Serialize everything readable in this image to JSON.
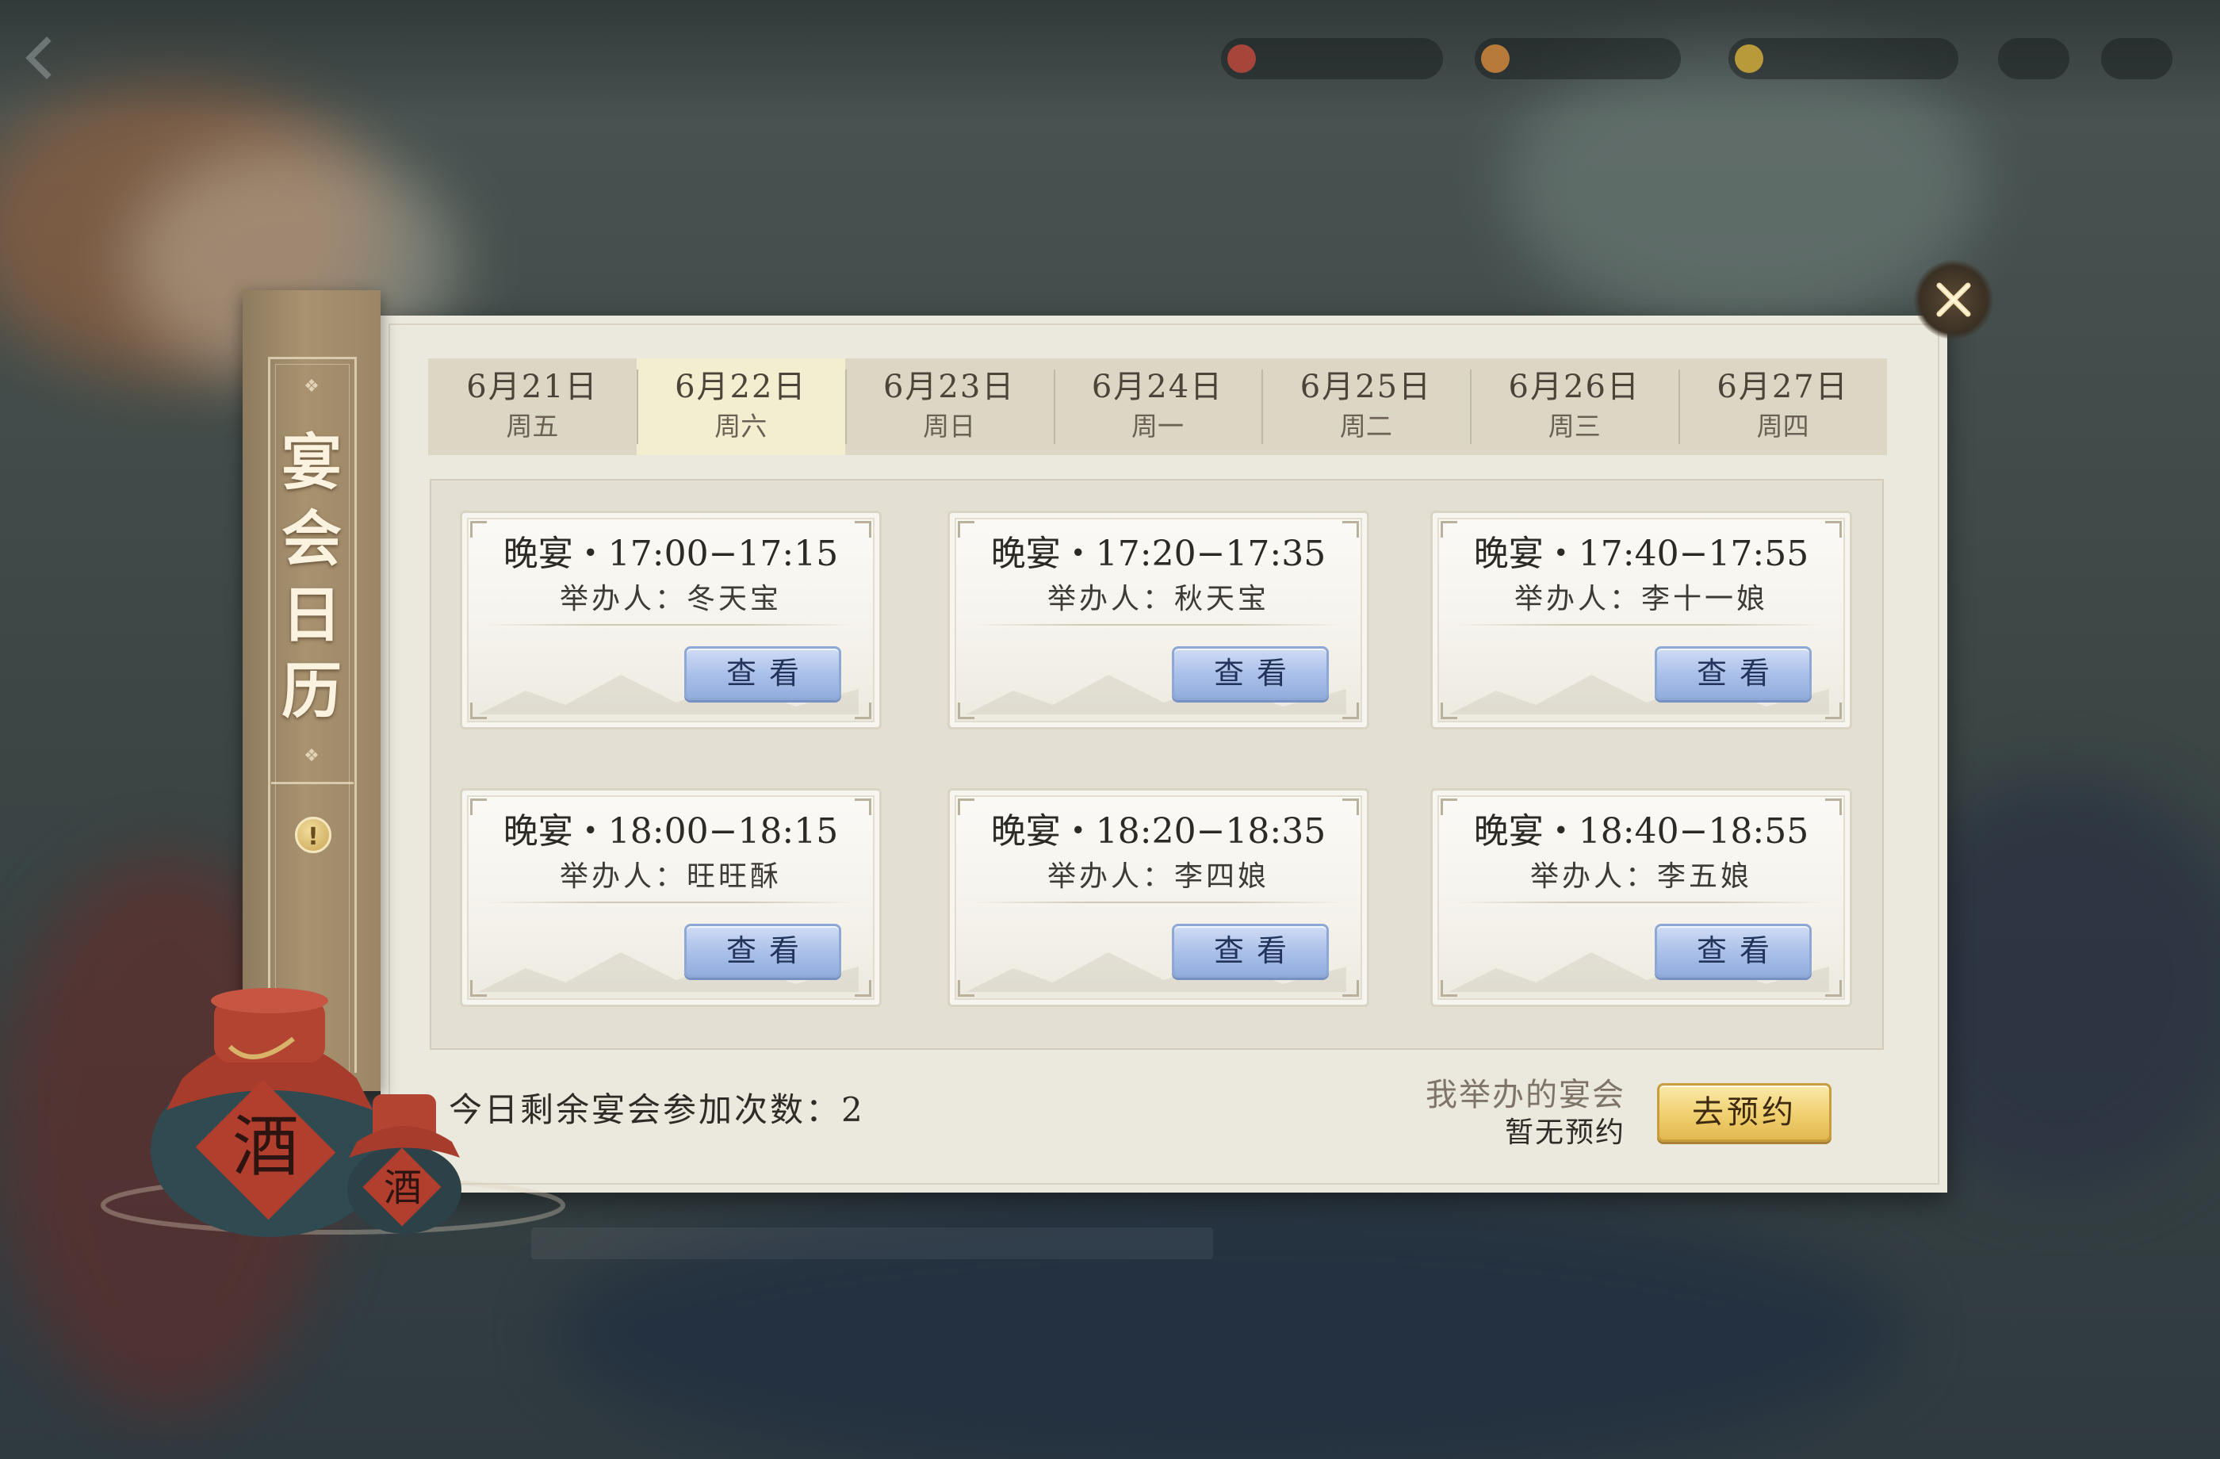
{
  "banner": {
    "title_chars": [
      "宴",
      "会",
      "日",
      "历"
    ],
    "info_glyph": "!"
  },
  "tabs": [
    {
      "date": "6月21日",
      "weekday": "周五",
      "active": false
    },
    {
      "date": "6月22日",
      "weekday": "周六",
      "active": true
    },
    {
      "date": "6月23日",
      "weekday": "周日",
      "active": false
    },
    {
      "date": "6月24日",
      "weekday": "周一",
      "active": false
    },
    {
      "date": "6月25日",
      "weekday": "周二",
      "active": false
    },
    {
      "date": "6月26日",
      "weekday": "周三",
      "active": false
    },
    {
      "date": "6月27日",
      "weekday": "周四",
      "active": false
    }
  ],
  "banquets": [
    {
      "time": "晚宴・17:00−17:15",
      "host": "举办人：冬天宝",
      "button": "查看"
    },
    {
      "time": "晚宴・17:20−17:35",
      "host": "举办人：秋天宝",
      "button": "查看"
    },
    {
      "time": "晚宴・17:40−17:55",
      "host": "举办人：李十一娘",
      "button": "查看"
    },
    {
      "time": "晚宴・18:00−18:15",
      "host": "举办人：旺旺酥",
      "button": "查看"
    },
    {
      "time": "晚宴・18:20−18:35",
      "host": "举办人：李四娘",
      "button": "查看"
    },
    {
      "time": "晚宴・18:40−18:55",
      "host": "举办人：李五娘",
      "button": "查看"
    }
  ],
  "footer": {
    "remaining_label": "今日剩余宴会参加次数：2",
    "my_banquet_label": "我举办的宴会",
    "my_banquet_status": "暂无预约",
    "reserve_button": "去预约"
  },
  "jars": {
    "label": "酒"
  },
  "colors": {
    "panel_bg": "#ebe8dd",
    "active_tab": "#f3eecf",
    "view_button": "#a9bfe8",
    "reserve_button": "#f0cf6f",
    "banner": "#a8926f"
  },
  "icons": {
    "close": "close-x-icon",
    "info": "info-exclamation-icon",
    "back": "back-arrow-icon"
  }
}
